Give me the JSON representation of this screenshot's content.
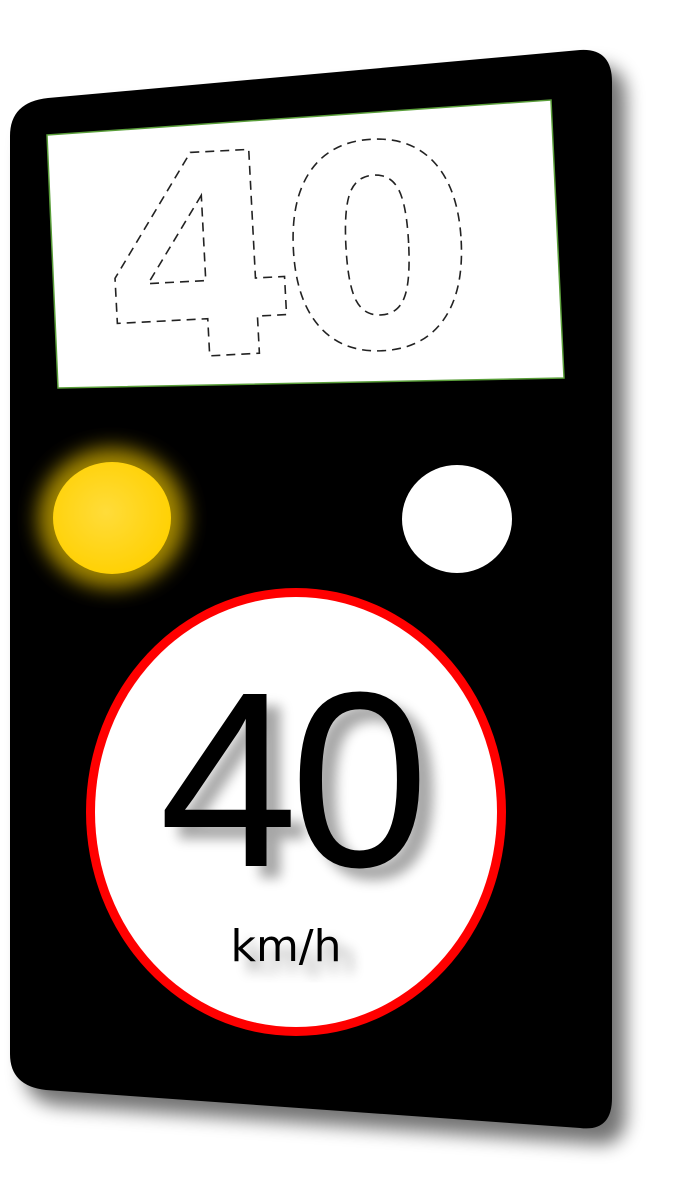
{
  "sign": {
    "display_value": "40",
    "limit_value": "40",
    "unit": "km/h",
    "colors": {
      "panel": "#000000",
      "display_bg": "#ffffff",
      "display_border": "#5a9e3a",
      "outline_digits": "#222222",
      "lamp_lit": "#ffd000",
      "lamp_glow": "#e8c000",
      "lamp_off": "#ffffff",
      "ring": "#ff0000",
      "roundel_bg": "#ffffff",
      "limit_text": "#000000"
    },
    "lamps": [
      {
        "name": "amber-lamp",
        "state": "lit"
      },
      {
        "name": "white-lamp",
        "state": "off"
      }
    ]
  }
}
